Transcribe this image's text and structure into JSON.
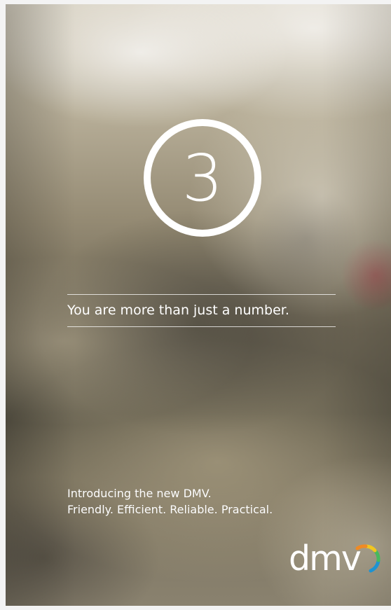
{
  "poster": {
    "number": "3",
    "tagline": "You are more than just a number.",
    "intro_line_1": "Introducing the new DMV.",
    "intro_line_2": "Friendly. Efficient. Reliable. Practical.",
    "logo_text": "dmv"
  },
  "colors": {
    "text": "#ffffff",
    "logo_arc_colors": [
      "#1d93d2",
      "#48b85d",
      "#f1c61f",
      "#f08a24"
    ]
  }
}
